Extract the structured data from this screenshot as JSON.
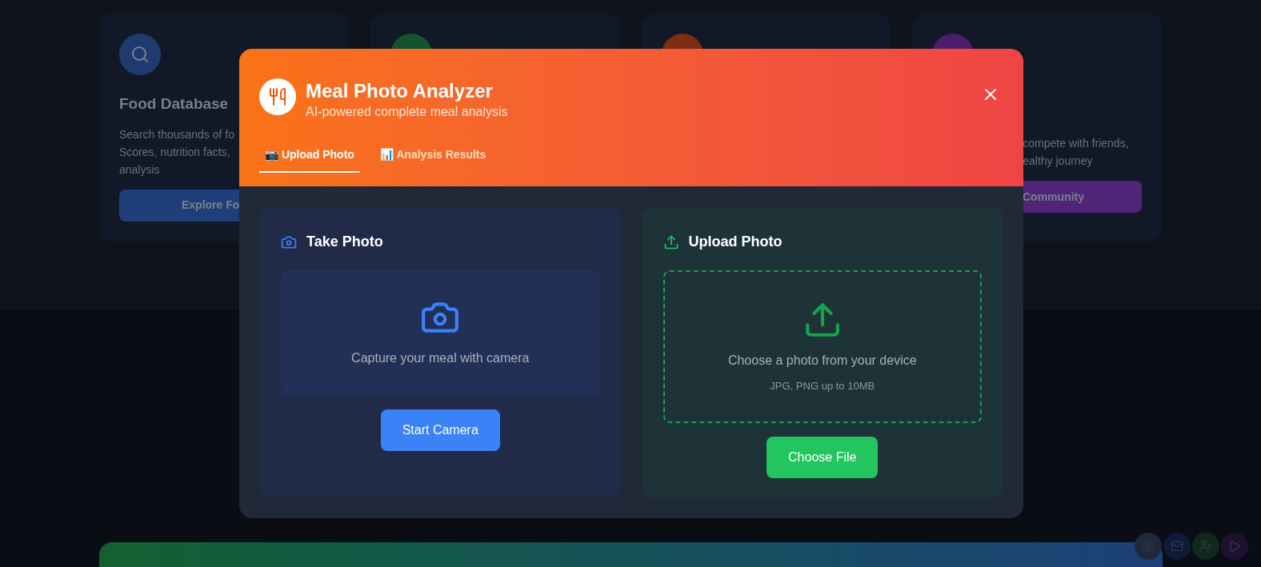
{
  "background_cards": [
    {
      "kind": "search",
      "color": "#1e3a6e",
      "title": "Food Database",
      "description_lines": [
        "Search thousands of fo",
        "Scores, nutrition facts,",
        "analysis"
      ],
      "button": "Explore Fo"
    },
    {
      "kind": "plain",
      "color": "#14532d"
    },
    {
      "kind": "plain",
      "color": "#7c2d12"
    },
    {
      "kind": "community",
      "color": "#4c1d6e",
      "description_lines": [
        "compete with friends,",
        "ealthy journey"
      ],
      "button": "Community"
    }
  ],
  "modal": {
    "title": "Meal Photo Analyzer",
    "subtitle": "AI-powered complete meal analysis",
    "tabs": [
      {
        "label": "📷 Upload Photo",
        "selected": true
      },
      {
        "label": "📊 Analysis Results",
        "selected": false
      }
    ],
    "panels": [
      {
        "kind": "camera",
        "heading": "Take Photo",
        "prompt": "Capture your meal with camera",
        "button": "Start Camera"
      },
      {
        "kind": "upload",
        "heading": "Upload Photo",
        "prompt": "Choose a photo from your device",
        "hint": "JPG, PNG up to 10MB",
        "button": "Choose File"
      }
    ]
  },
  "floating_buttons": [
    {
      "kind": "settings",
      "color": "#1e293b"
    },
    {
      "kind": "mail",
      "color": "#0f1a3a"
    },
    {
      "kind": "add-user",
      "color": "#0f2a1c"
    },
    {
      "kind": "play",
      "color": "#1c1230"
    }
  ]
}
